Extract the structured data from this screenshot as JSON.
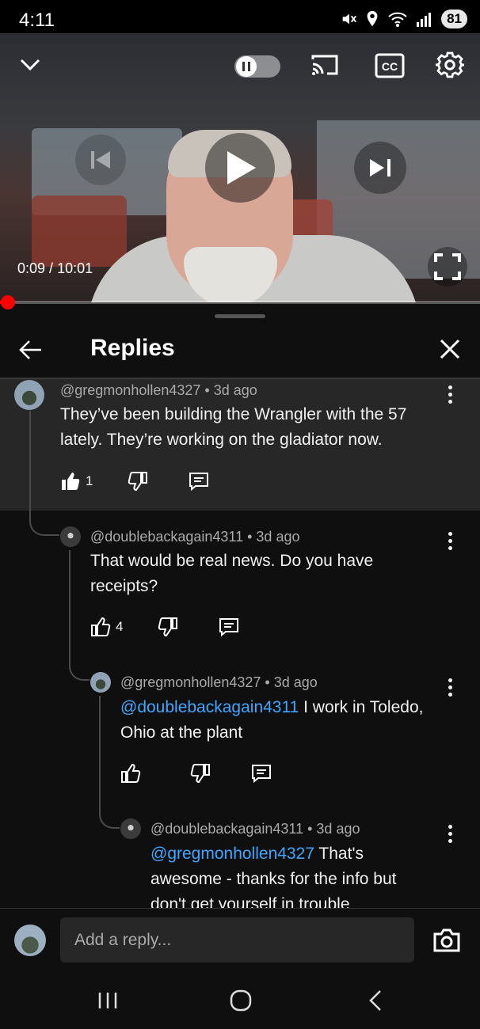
{
  "status_bar": {
    "time": "4:11",
    "battery": "81",
    "icons": [
      "mute-icon",
      "location-icon",
      "wifi-icon",
      "signal-icon",
      "battery-icon"
    ]
  },
  "video": {
    "time_current": "0:09",
    "time_total": "10:01",
    "time_separator": " / ",
    "progress": 0.015
  },
  "panel": {
    "title": "Replies"
  },
  "comments": [
    {
      "author": "@gregmonhollen4327",
      "age": "3d ago",
      "text": "They’ve been building the Wrangler with the 57 lately. They’re working on the gladiator now.",
      "likes": "1"
    },
    {
      "author": "@doublebackagain4311",
      "age": "3d ago",
      "text": "That would be real news. Do you have receipts?",
      "likes": "4"
    },
    {
      "author": "@gregmonhollen4327",
      "age": "3d ago",
      "mention": "@doublebackagain4311",
      "text": " I work in Toledo, Ohio at the plant",
      "likes": ""
    },
    {
      "author": "@doublebackagain4311",
      "age": "3d ago",
      "mention": "@gregmonhollen4327",
      "text": " That's awesome - thanks for the info but don't get yourself in trouble"
    }
  ],
  "reply_bar": {
    "placeholder": "Add a reply..."
  },
  "colors": {
    "background": "#0f0f0f",
    "parent_highlight": "#272727",
    "mention": "#3ea6ff",
    "progress": "#ff0000"
  }
}
